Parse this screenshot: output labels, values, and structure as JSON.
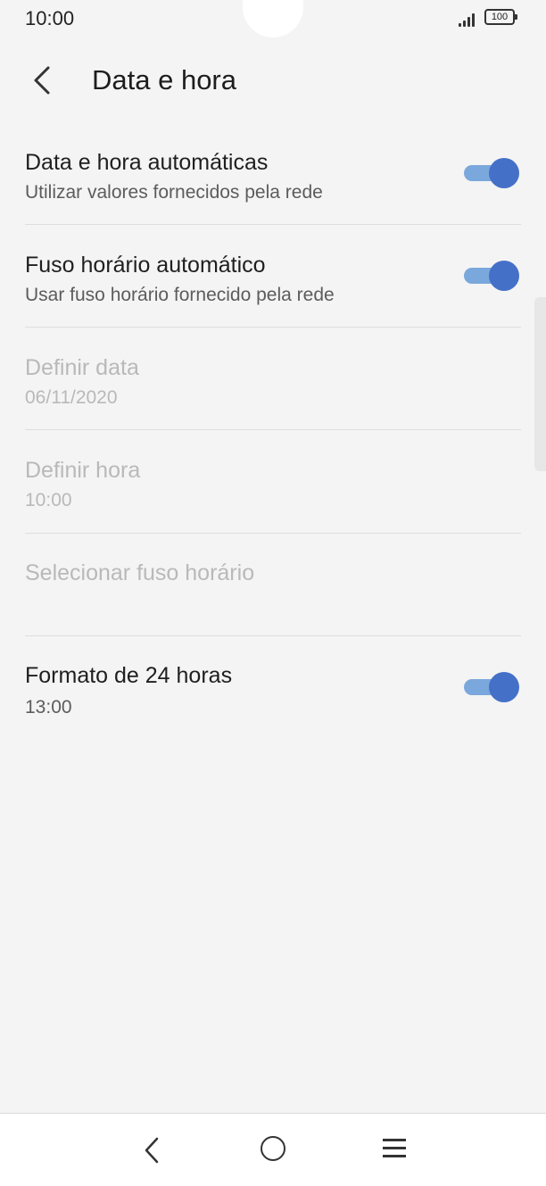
{
  "status_bar": {
    "time": "10:00",
    "battery": "100",
    "icons": [
      "signal-icon",
      "battery-icon"
    ]
  },
  "header": {
    "title": "Data e hora",
    "back_icon": "back-arrow-icon"
  },
  "settings": [
    {
      "id": "auto-date-time",
      "title": "Data e hora automáticas",
      "subtitle": "Utilizar valores fornecidos pela rede",
      "toggle": true,
      "toggle_on": true,
      "enabled": true
    },
    {
      "id": "auto-timezone",
      "title": "Fuso horário automático",
      "subtitle": "Usar fuso horário fornecido pela rede",
      "toggle": true,
      "toggle_on": true,
      "enabled": true
    },
    {
      "id": "set-date",
      "title": "Definir data",
      "subtitle": "06/11/2020",
      "toggle": false,
      "enabled": false
    },
    {
      "id": "set-time",
      "title": "Definir hora",
      "subtitle": "10:00",
      "toggle": false,
      "enabled": false
    },
    {
      "id": "select-timezone",
      "title": "Selecionar fuso horário",
      "subtitle": "",
      "toggle": false,
      "enabled": false
    },
    {
      "id": "24-hour-format",
      "title": "Formato de 24 horas",
      "subtitle": "13:00",
      "toggle": true,
      "toggle_on": true,
      "enabled": true
    }
  ],
  "nav_bar": {
    "icons": [
      "back-icon",
      "home-icon",
      "menu-icon"
    ]
  },
  "colors": {
    "toggle_thumb": "#4470c8",
    "toggle_track": "#7aa8dc",
    "background": "#f4f4f4",
    "disabled_text": "#b9b9b9"
  }
}
